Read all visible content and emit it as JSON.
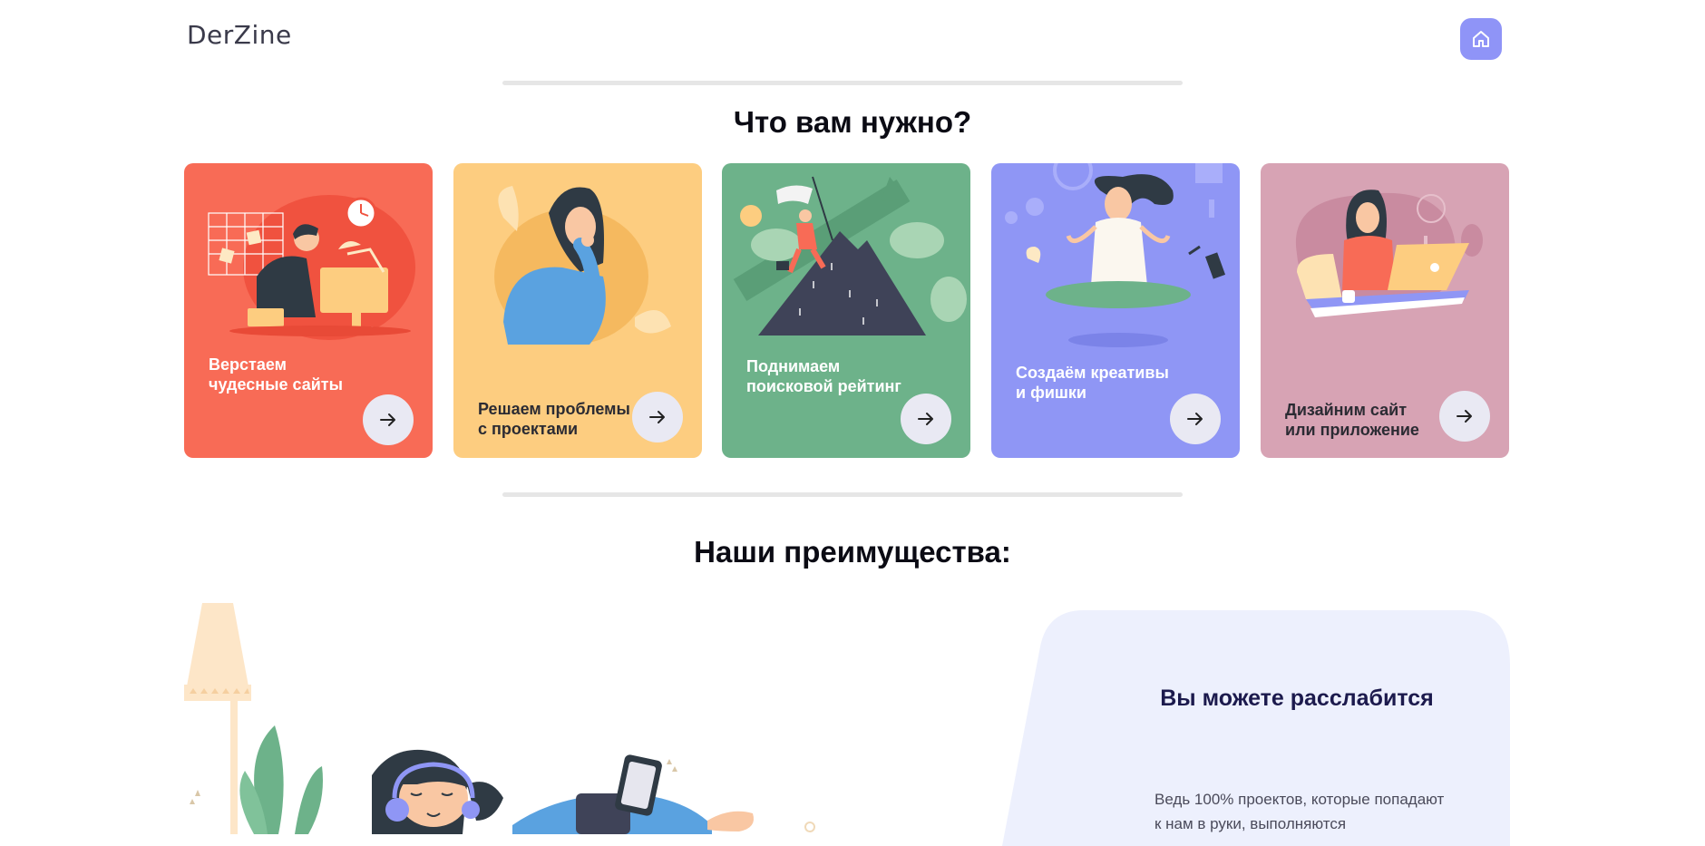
{
  "header": {
    "logo": "DerZine",
    "home_icon": "home-icon"
  },
  "services": {
    "title": "Что вам нужно?",
    "cards": [
      {
        "line1": "Верстаем",
        "line2": "чудесные сайты",
        "color": "#f86b56",
        "text_color": "#ffffff",
        "icon": "arrow-right-icon"
      },
      {
        "line1": "Решаем проблемы",
        "line2": "с проектами",
        "color": "#fdcd80",
        "text_color": "#2b2b33",
        "icon": "arrow-right-icon"
      },
      {
        "line1": "Поднимаем",
        "line2": "поисковой рейтинг",
        "color": "#6db28a",
        "text_color": "#ffffff",
        "icon": "arrow-right-icon"
      },
      {
        "line1": "Создаём креативы",
        "line2": "и фишки",
        "color": "#8f96f5",
        "text_color": "#ffffff",
        "icon": "arrow-right-icon"
      },
      {
        "line1": "Дизайним сайт",
        "line2": "или приложение",
        "color": "#d7a3b4",
        "text_color": "#2b2b33",
        "icon": "arrow-right-icon"
      }
    ]
  },
  "advantages": {
    "title": "Наши преимущества:",
    "panel_title": "Вы можете расслабится",
    "panel_text": "Ведь 100% проектов, которые попадают к нам в руки, выполняются"
  }
}
